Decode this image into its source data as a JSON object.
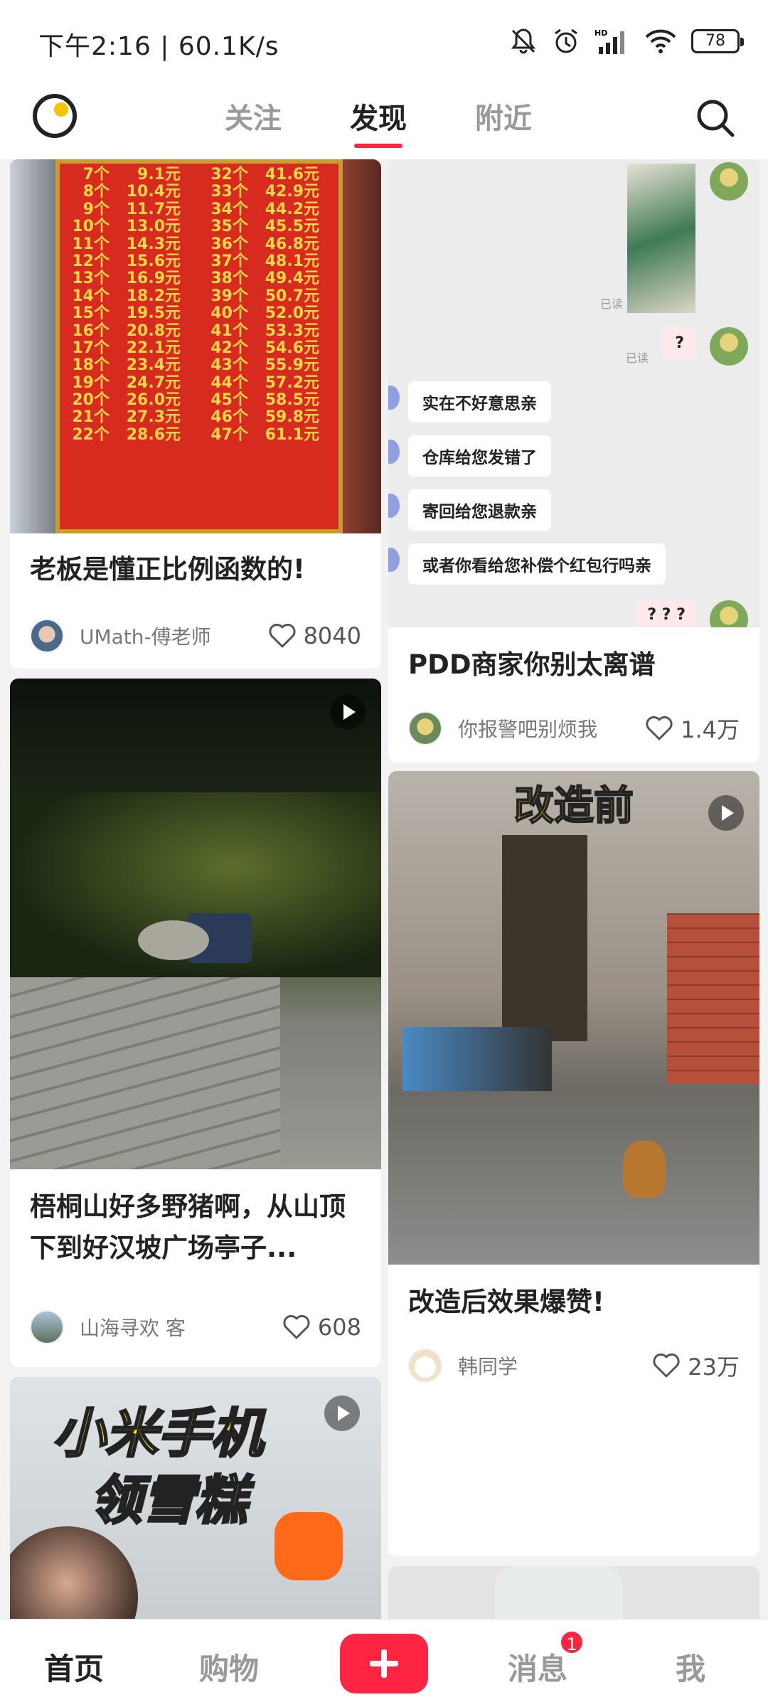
{
  "status_bar": {
    "text": "下午2:16 | 60.1K/s",
    "battery": "78",
    "icons": [
      "mute-icon",
      "alarm-icon",
      "signal-icon",
      "wifi-icon",
      "battery-icon"
    ]
  },
  "top_nav": {
    "tabs": [
      {
        "label": "关注",
        "active": false
      },
      {
        "label": "发现",
        "active": true
      },
      {
        "label": "附近",
        "active": false
      }
    ],
    "accent": "#ff2442"
  },
  "price_table": [
    [
      "7个",
      "9.1元",
      "32个",
      "41.6元"
    ],
    [
      "8个",
      "10.4元",
      "33个",
      "42.9元"
    ],
    [
      "9个",
      "11.7元",
      "34个",
      "44.2元"
    ],
    [
      "10个",
      "13.0元",
      "35个",
      "45.5元"
    ],
    [
      "11个",
      "14.3元",
      "36个",
      "46.8元"
    ],
    [
      "12个",
      "15.6元",
      "37个",
      "48.1元"
    ],
    [
      "13个",
      "16.9元",
      "38个",
      "49.4元"
    ],
    [
      "14个",
      "18.2元",
      "39个",
      "50.7元"
    ],
    [
      "15个",
      "19.5元",
      "40个",
      "52.0元"
    ],
    [
      "16个",
      "20.8元",
      "41个",
      "53.3元"
    ],
    [
      "17个",
      "22.1元",
      "42个",
      "54.6元"
    ],
    [
      "18个",
      "23.4元",
      "43个",
      "55.9元"
    ],
    [
      "19个",
      "24.7元",
      "44个",
      "57.2元"
    ],
    [
      "20个",
      "26.0元",
      "45个",
      "58.5元"
    ],
    [
      "21个",
      "27.3元",
      "46个",
      "59.8元"
    ],
    [
      "22个",
      "28.6元",
      "47个",
      "61.1元"
    ]
  ],
  "chat": {
    "read_label": "已读",
    "question": "?",
    "questions3": "? ? ?",
    "messages": [
      "实在不好意思亲",
      "仓库给您发错了",
      "寄回给您退款亲",
      "或者你看给您补偿个红包行吗亲"
    ]
  },
  "cards": {
    "c1": {
      "title": "老板是懂正比例函数的!",
      "author": "UMath-傅老师",
      "likes": "8040"
    },
    "c2": {
      "title": "PDD商家你别太离谱",
      "author": "你报警吧别烦我",
      "likes": "1.4万"
    },
    "c3": {
      "title": "梧桐山好多野猪啊，从山顶下到好汉坡广场亭子...",
      "author": "山海寻欢 客",
      "likes": "608"
    },
    "c4": {
      "title": "改造后效果爆赞!",
      "author": "韩同学",
      "likes": "23万",
      "overlay": "改造前"
    },
    "c5": {
      "overlay_line1": "小米手机",
      "overlay_line2": "领雪糕"
    }
  },
  "bottom_nav": {
    "items": [
      "首页",
      "购物",
      "消息",
      "我"
    ],
    "badge": "1"
  }
}
